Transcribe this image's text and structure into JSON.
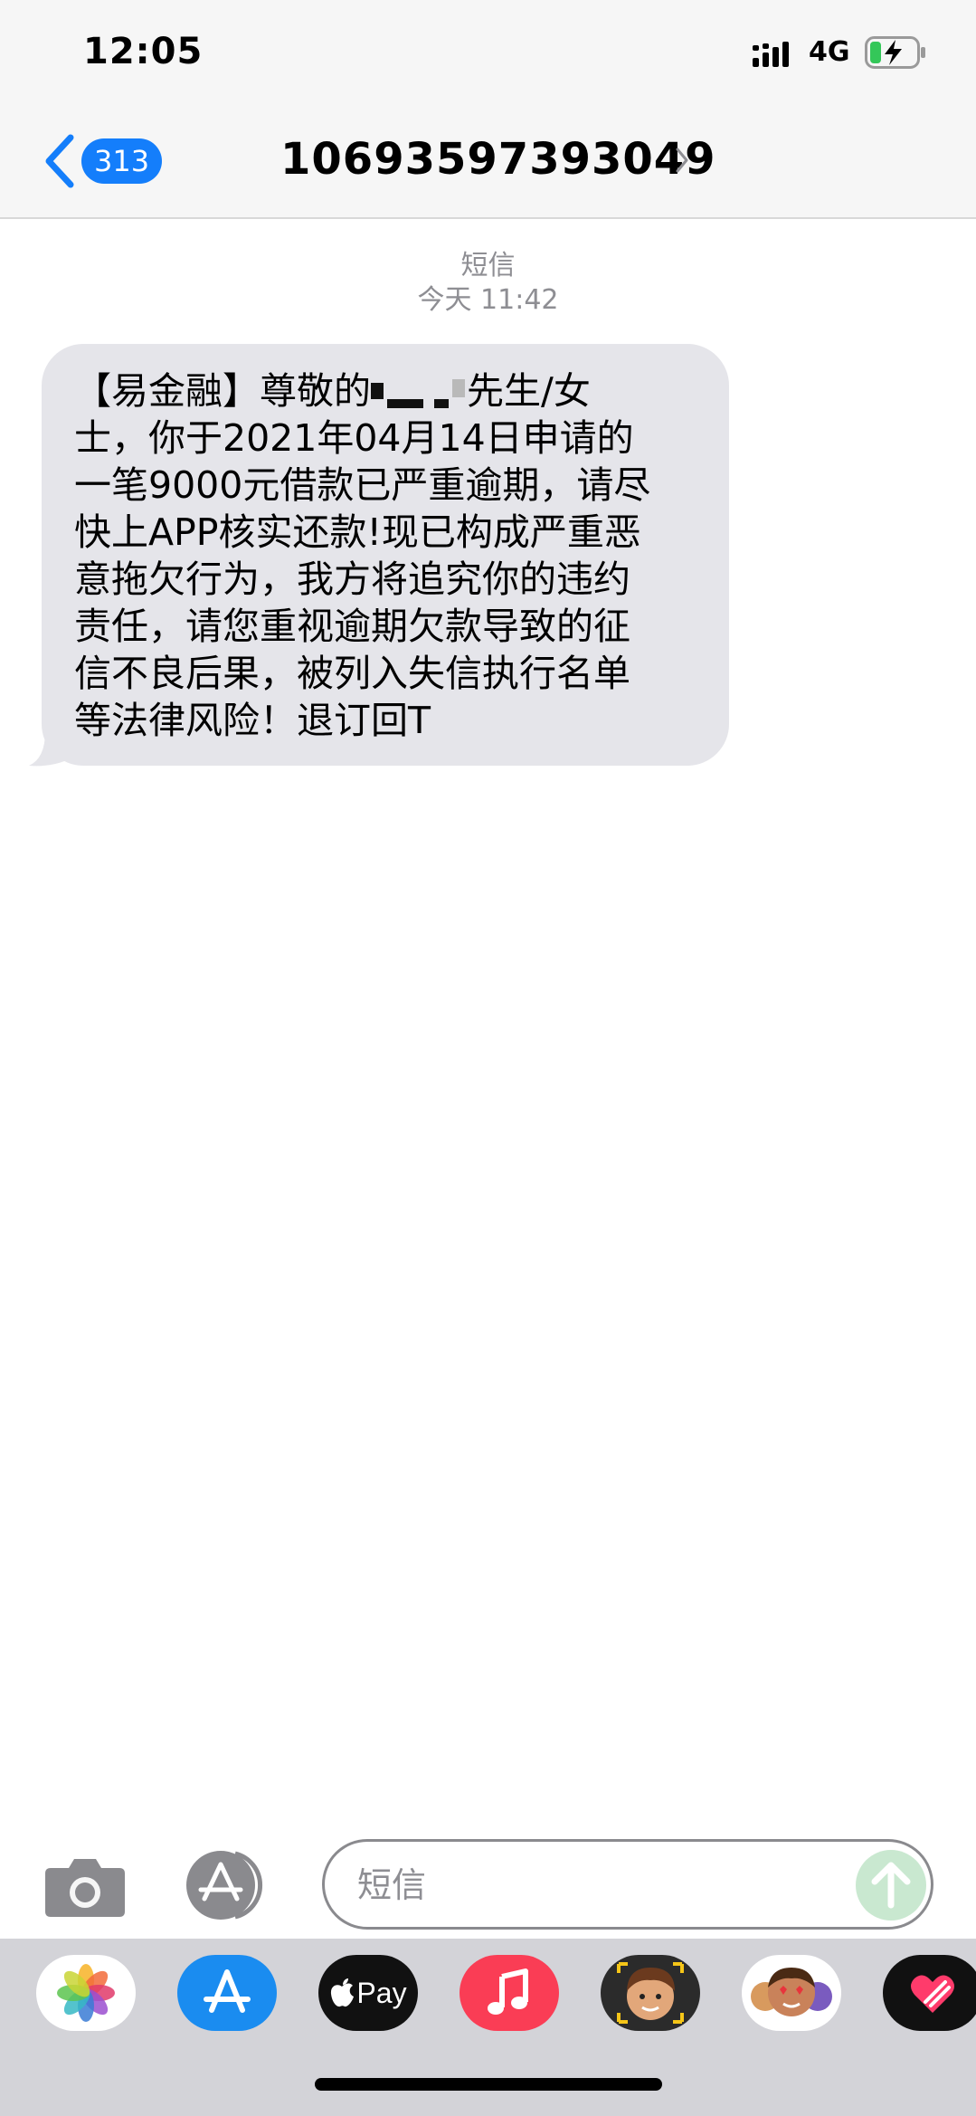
{
  "status_bar": {
    "time": "12:05",
    "network": "4G",
    "icons": [
      "signal-icon",
      "battery-charging-icon"
    ]
  },
  "nav": {
    "back_count": "313",
    "contact": "10693597393049",
    "icons": [
      "back-chevron-icon",
      "chevron-right-icon"
    ]
  },
  "conversation": {
    "service_label": "短信",
    "timestamp": "今天 11:42",
    "message": {
      "line1a": "【易金融】尊敬的",
      "line1b": "先生/女",
      "line2": "士，你于2021年04月14日申请的",
      "line3": "一笔9000元借款已严重逾期，请尽",
      "line4": "快上APP核实还款!现已构成严重恶",
      "line5": "意拖欠行为，我方将追究你的违约",
      "line6": "责任，请您重视逾期欠款导致的征",
      "line7": "信不良后果，被列入失信执行名单",
      "line8": "等法律风险！退订回T"
    }
  },
  "input_bar": {
    "placeholder": "短信",
    "icons": [
      "camera-icon",
      "app-store-icon",
      "send-arrow-icon"
    ]
  },
  "app_drawer": {
    "apps": [
      {
        "name": "photos-icon"
      },
      {
        "name": "app-store-icon"
      },
      {
        "name": "apple-pay-icon",
        "label": "Pay"
      },
      {
        "name": "music-icon"
      },
      {
        "name": "memoji-icon"
      },
      {
        "name": "animoji-icon"
      },
      {
        "name": "digital-touch-icon"
      }
    ]
  },
  "colors": {
    "accent": "#147efb",
    "bubble": "#e5e5ea",
    "header": "#f6f6f6",
    "drawer": "#d3d3d8",
    "send_disabled": "#c9e8d0"
  }
}
